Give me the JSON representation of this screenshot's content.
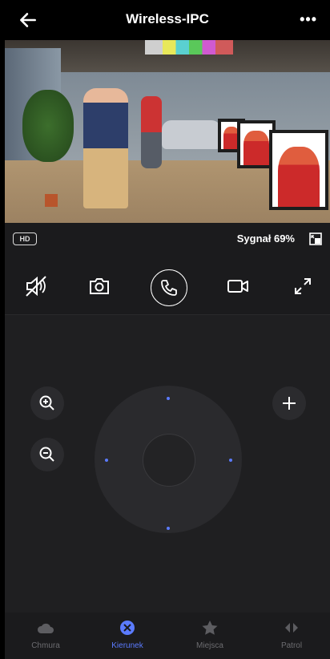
{
  "header": {
    "title": "Wireless-IPC",
    "more_label": "•••"
  },
  "video": {
    "hd_label": "HD",
    "signal_text": "Sygnał 69%"
  },
  "controls": {
    "mute": "speaker-muted-icon",
    "snapshot": "camera-icon",
    "call": "phone-icon",
    "record": "video-record-icon",
    "fullscreen": "expand-icon"
  },
  "ptz": {
    "zoom_in": "zoom-in-icon",
    "zoom_out": "zoom-out-icon",
    "add": "plus-icon"
  },
  "tabs": [
    {
      "label": "Chmura",
      "icon": "cloud-icon",
      "active": false
    },
    {
      "label": "Kierunek",
      "icon": "direction-icon",
      "active": true
    },
    {
      "label": "Miejsca",
      "icon": "star-icon",
      "active": false
    },
    {
      "label": "Patrol",
      "icon": "patrol-icon",
      "active": false
    }
  ],
  "colors": {
    "accent": "#5b7bff",
    "background": "#1b1b1d"
  }
}
